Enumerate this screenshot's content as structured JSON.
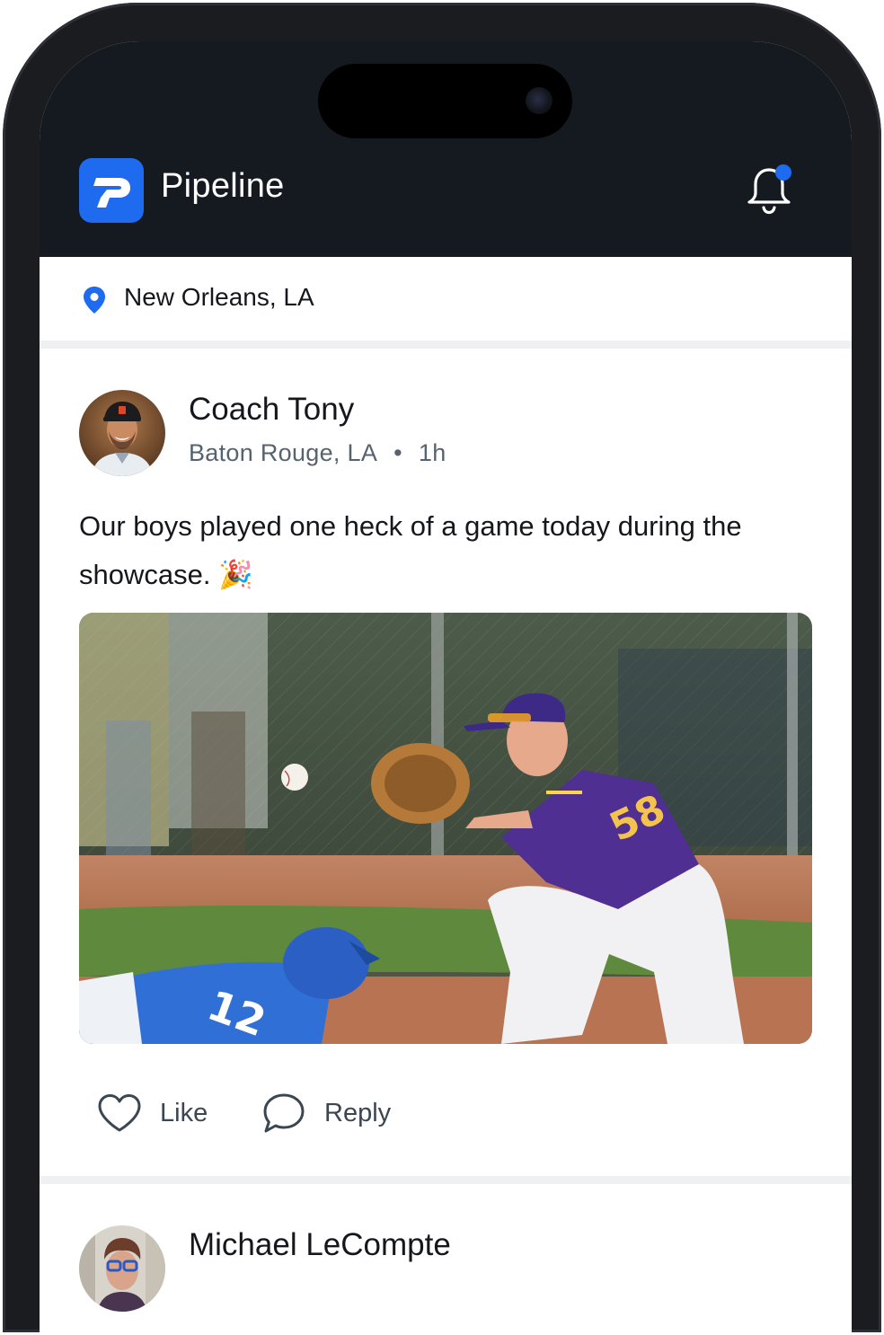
{
  "app": {
    "title": "Pipeline",
    "accent_color": "#1f6bf0",
    "header_bg": "#151a20",
    "logo_icon": "pipeline-logo-icon",
    "notification_icon": "bell-icon",
    "has_unread_notifications": true
  },
  "location": {
    "icon": "map-pin-icon",
    "label": "New Orleans, LA"
  },
  "posts": [
    {
      "author": "Coach Tony",
      "location": "Baton Rouge, LA",
      "separator": "•",
      "time": "1h",
      "text": "Our boys played one heck of a game today during the showcase. 🎉",
      "image_description": "baseball player in purple jersey catching ball at base as runner in blue jersey number 12 slides in",
      "actions": {
        "like_label": "Like",
        "like_icon": "heart-icon",
        "reply_label": "Reply",
        "reply_icon": "speech-bubble-icon"
      }
    },
    {
      "author": "Michael LeCompte"
    }
  ]
}
